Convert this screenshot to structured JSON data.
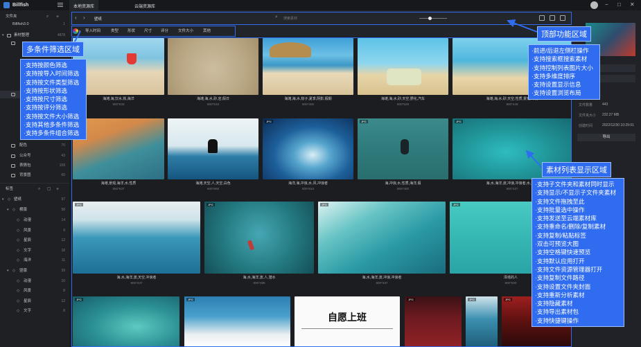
{
  "app": {
    "name": "Billfish",
    "tabs": [
      "本地资源库",
      "云端资源库"
    ]
  },
  "sidebar": {
    "library_label": "文件夹",
    "library_name": "Billfish3.0",
    "library_count": "1",
    "folder_group": "素材整理",
    "folder_count": "4878",
    "folders": [
      {
        "name": "配色",
        "count": "70"
      },
      {
        "name": "公众号",
        "count": "43"
      },
      {
        "name": "表情包",
        "count": "109"
      },
      {
        "name": "背景图",
        "count": "60"
      }
    ],
    "tags_label": "标签",
    "tag_root": {
      "name": "壁纸",
      "count": "97"
    },
    "tag_groups": [
      {
        "name": "横版",
        "count": "58",
        "children": [
          {
            "name": "动漫",
            "count": "14"
          },
          {
            "name": "风景",
            "count": "9"
          },
          {
            "name": "星辰",
            "count": "12"
          },
          {
            "name": "文字",
            "count": "18"
          },
          {
            "name": "海洋",
            "count": "11"
          }
        ]
      },
      {
        "name": "竖版",
        "count": "39",
        "children": [
          {
            "name": "动漫",
            "count": "10"
          },
          {
            "name": "风景",
            "count": "8"
          },
          {
            "name": "星辰",
            "count": "12"
          },
          {
            "name": "文字",
            "count": "8"
          }
        ]
      }
    ]
  },
  "toolbar": {
    "breadcrumb": "壁纸",
    "search_placeholder": "搜索素材"
  },
  "filters": [
    "导入时间",
    "类型",
    "形状",
    "尺寸",
    "评分",
    "文件大小",
    "其他"
  ],
  "grid": {
    "rows": [
      {
        "items": [
          {
            "caption": "海滩,海,饮水,铁,海洋",
            "size": "800*533"
          },
          {
            "caption": "海滩,海,水,砂,岩,假日",
            "size": "800*533"
          },
          {
            "caption": "海滩,海,水,棕子,夏季,阴影,假期",
            "size": "800*400"
          },
          {
            "caption": "海滩,海,水,砂,天空,野化,汽车",
            "size": "800*529"
          },
          {
            "caption": "海滩,海,水,砂,天空,性质,景观,冲浪",
            "size": "800*449"
          }
        ]
      },
      {
        "items": [
          {
            "caption": "海滩,景观,海洋,水,性质",
            "size": "800*537"
          },
          {
            "caption": "海滩,天空,人,天空,白色",
            "size": "800*800"
          },
          {
            "caption": "海洋,海,冲浪,水,风,冲浪者",
            "size": "800*534"
          },
          {
            "caption": "海,冲浪,水,性质,海洋,假",
            "size": "800*400"
          },
          {
            "caption": "海,水,海洋,波,冲浪,冲浪者,水,运动",
            "size": "800*327"
          }
        ]
      },
      {
        "items": [
          {
            "caption": "海,水,海洋,波,天空,冲浪者",
            "size": "800*337"
          },
          {
            "caption": "海,水,海洋,波,人,潜水",
            "size": "800*395"
          },
          {
            "caption": "海,水,海洋,波,冲浪,冲浪者",
            "size": "800*337"
          },
          {
            "caption": "泽塔的人",
            "size": "800*500"
          }
        ]
      },
      {
        "items": [
          {
            "caption": "",
            "size": ""
          },
          {
            "caption": "",
            "size": ""
          },
          {
            "caption": "自愿上班",
            "size": ""
          },
          {
            "caption": "",
            "size": ""
          },
          {
            "caption": "",
            "size": ""
          },
          {
            "caption": "",
            "size": ""
          }
        ]
      }
    ]
  },
  "right_panel": {
    "rows": [
      {
        "label": "文件数量",
        "value": "443"
      },
      {
        "label": "文件夹大小",
        "value": "232.27 MB"
      },
      {
        "label": "创建时间",
        "value": "2022/12/30 10:29:01"
      }
    ],
    "export_label": "导出"
  },
  "annotations": {
    "top": {
      "title": "顶部功能区域",
      "items": [
        "·前进/后退左侧栏操作",
        "·支持搜索框搜索素材",
        "·支持控制列表图片大小",
        "·支持多维度排序",
        "·支持设置显示信息",
        "·支持设置浏览布局"
      ]
    },
    "filter": {
      "title": "多条件筛选区域",
      "items": [
        "·支持按颜色筛选",
        "·支持按导入时间筛选",
        "·支持按文件类型筛选",
        "·支持按形状筛选",
        "·支持按尺寸筛选",
        "·支持按评分筛选",
        "·支持按文件大小筛选",
        "·支持其他多条件筛选",
        "·支持多条件组合筛选"
      ]
    },
    "grid": {
      "title": "素材列表显示区域",
      "items": [
        "·支持子文件夹和素材同时显示",
        "·支持显示/不显示子文件夹素材",
        "·支持文件拖拽至此",
        "·支持批量选中操作",
        "·支持发送至云端素材库",
        "·支持重命名/删除/复制素材",
        "·支持复制/粘贴标签",
        "·双击可预览大图",
        "·支持空格键快速预览",
        "·支持默认应用打开",
        "·支持文件资源管理器打开",
        "·支持复制文件路径",
        "·支持设置文件夹封面",
        "·支持重新分析素材",
        "·支持隐藏素材",
        "·支持导出素材包",
        "·支持快捷键操作"
      ]
    }
  },
  "colors": {
    "accent": "#2f6cf0",
    "background": "#1b1d21",
    "sidebar": "#1e2024"
  },
  "icons": {
    "logo": "billfish-logo-icon",
    "search": "search-icon",
    "add": "plus-icon",
    "folder": "folder-icon",
    "tag": "tag-icon",
    "back": "chevron-left-icon",
    "forward": "chevron-right-icon",
    "dropdown": "chevron-down-icon"
  }
}
